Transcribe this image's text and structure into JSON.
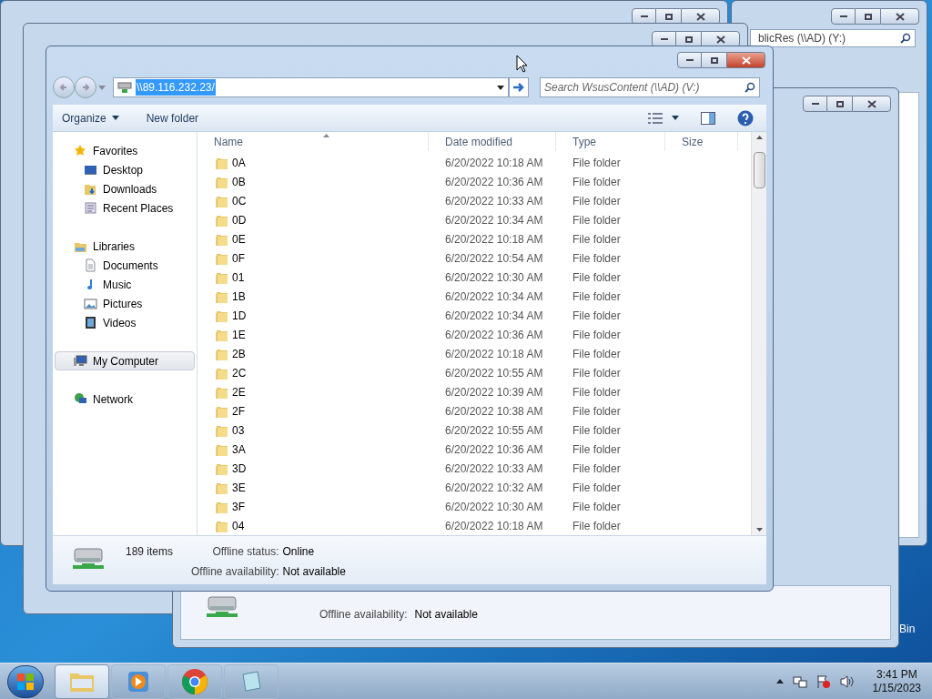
{
  "background_windows": {
    "search_text": "blicRes (\\\\AD) (Y:)",
    "status_label": "Offline availability:",
    "status_value": "Not available"
  },
  "desktop": {
    "icon_label": "Bin"
  },
  "window": {
    "address": "\\\\89.116.232.23/",
    "search": {
      "placeholder": "Search WsusContent (\\\\AD) (V:)"
    },
    "toolbar": [
      "Organize",
      "New folder"
    ],
    "nav": [
      {
        "label": "Favorites",
        "kind": "star",
        "selected": false,
        "children": [
          {
            "label": "Desktop",
            "kind": "desktop",
            "selected": false
          },
          {
            "label": "Downloads",
            "kind": "downloads",
            "selected": false
          },
          {
            "label": "Recent Places",
            "kind": "recent",
            "selected": false
          }
        ]
      },
      {
        "label": "Libraries",
        "kind": "libraries",
        "selected": false,
        "children": [
          {
            "label": "Documents",
            "kind": "document",
            "selected": false
          },
          {
            "label": "Music",
            "kind": "music",
            "selected": false
          },
          {
            "label": "Pictures",
            "kind": "pictures",
            "selected": false
          },
          {
            "label": "Videos",
            "kind": "videos",
            "selected": false
          }
        ]
      },
      {
        "label": "My Computer",
        "kind": "computer",
        "selected": true
      },
      {
        "label": "Network",
        "kind": "network",
        "selected": false
      }
    ],
    "columns": [
      "Name",
      "Date modified",
      "Type",
      "Size"
    ],
    "rows": [
      [
        "0A",
        "6/20/2022 10:18 AM",
        "File folder"
      ],
      [
        "0B",
        "6/20/2022 10:36 AM",
        "File folder"
      ],
      [
        "0C",
        "6/20/2022 10:33 AM",
        "File folder"
      ],
      [
        "0D",
        "6/20/2022 10:34 AM",
        "File folder"
      ],
      [
        "0E",
        "6/20/2022 10:18 AM",
        "File folder"
      ],
      [
        "0F",
        "6/20/2022 10:54 AM",
        "File folder"
      ],
      [
        "01",
        "6/20/2022 10:30 AM",
        "File folder"
      ],
      [
        "1B",
        "6/20/2022 10:34 AM",
        "File folder"
      ],
      [
        "1D",
        "6/20/2022 10:34 AM",
        "File folder"
      ],
      [
        "1E",
        "6/20/2022 10:36 AM",
        "File folder"
      ],
      [
        "2B",
        "6/20/2022 10:18 AM",
        "File folder"
      ],
      [
        "2C",
        "6/20/2022 10:55 AM",
        "File folder"
      ],
      [
        "2E",
        "6/20/2022 10:39 AM",
        "File folder"
      ],
      [
        "2F",
        "6/20/2022 10:38 AM",
        "File folder"
      ],
      [
        "03",
        "6/20/2022 10:55 AM",
        "File folder"
      ],
      [
        "3A",
        "6/20/2022 10:36 AM",
        "File folder"
      ],
      [
        "3D",
        "6/20/2022 10:33 AM",
        "File folder"
      ],
      [
        "3E",
        "6/20/2022 10:32 AM",
        "File folder"
      ],
      [
        "3F",
        "6/20/2022 10:30 AM",
        "File folder"
      ],
      [
        "04",
        "6/20/2022 10:18 AM",
        "File folder"
      ]
    ],
    "status": {
      "count": "189 items",
      "fields": [
        {
          "label": "Offline status:",
          "value": "Online"
        },
        {
          "label": "Offline availability:",
          "value": "Not available"
        }
      ]
    }
  },
  "taskbar": {
    "apps": [
      {
        "kind": "explorer",
        "selected": true
      },
      {
        "kind": "media",
        "selected": false
      },
      {
        "kind": "browser",
        "selected": false
      },
      {
        "kind": "notepad",
        "selected": false
      }
    ],
    "time": "3:41 PM",
    "date": "1/15/2023"
  }
}
